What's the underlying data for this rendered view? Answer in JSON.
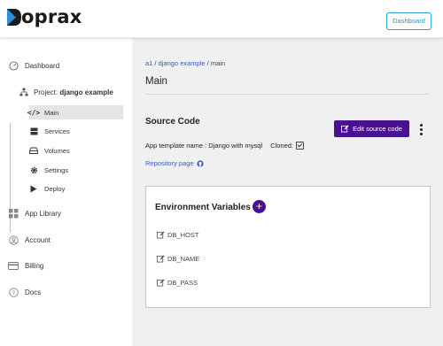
{
  "brand": {
    "name": "oprax",
    "letter": "D"
  },
  "header": {
    "dashboard_button": "Dashboard"
  },
  "sidebar": {
    "items": [
      {
        "label": "Dashboard",
        "icon": "gauge-icon"
      },
      {
        "label": "App Library",
        "icon": "grid-icon"
      },
      {
        "label": "Account",
        "icon": "user-circle-icon"
      },
      {
        "label": "Billing",
        "icon": "card-icon"
      },
      {
        "label": "Docs",
        "icon": "help-circle-icon"
      }
    ],
    "project": {
      "prefix": "Project:",
      "name": "django example",
      "icon": "sitemap-icon"
    },
    "subitems": [
      {
        "label": "Main",
        "icon": "code-icon",
        "active": true
      },
      {
        "label": "Services",
        "icon": "server-icon"
      },
      {
        "label": "Volumes",
        "icon": "hdd-icon"
      },
      {
        "label": "Settings",
        "icon": "gear-icon"
      },
      {
        "label": "Deploy",
        "icon": "play-icon"
      }
    ]
  },
  "breadcrumb": {
    "part1": "a1",
    "sep1": " / ",
    "part2": "django example",
    "sep2": " / ",
    "current": "main"
  },
  "page": {
    "title": "Main"
  },
  "source_code": {
    "title": "Source Code",
    "edit_button": "Edit source code",
    "template_text": "App template name : Django with mysql",
    "cloned_label": "Cloned:",
    "cloned": true,
    "repo_link": "Repository page"
  },
  "env": {
    "title": "Environment Variables",
    "add_symbol": "+",
    "vars": [
      "DB_HOST",
      "DB_NAME",
      "DB_PASS"
    ]
  },
  "colors": {
    "accent": "#4b0f94",
    "link": "#3b5bb8",
    "header_button": "#29a3d8",
    "main_bg": "#eef0f2"
  }
}
